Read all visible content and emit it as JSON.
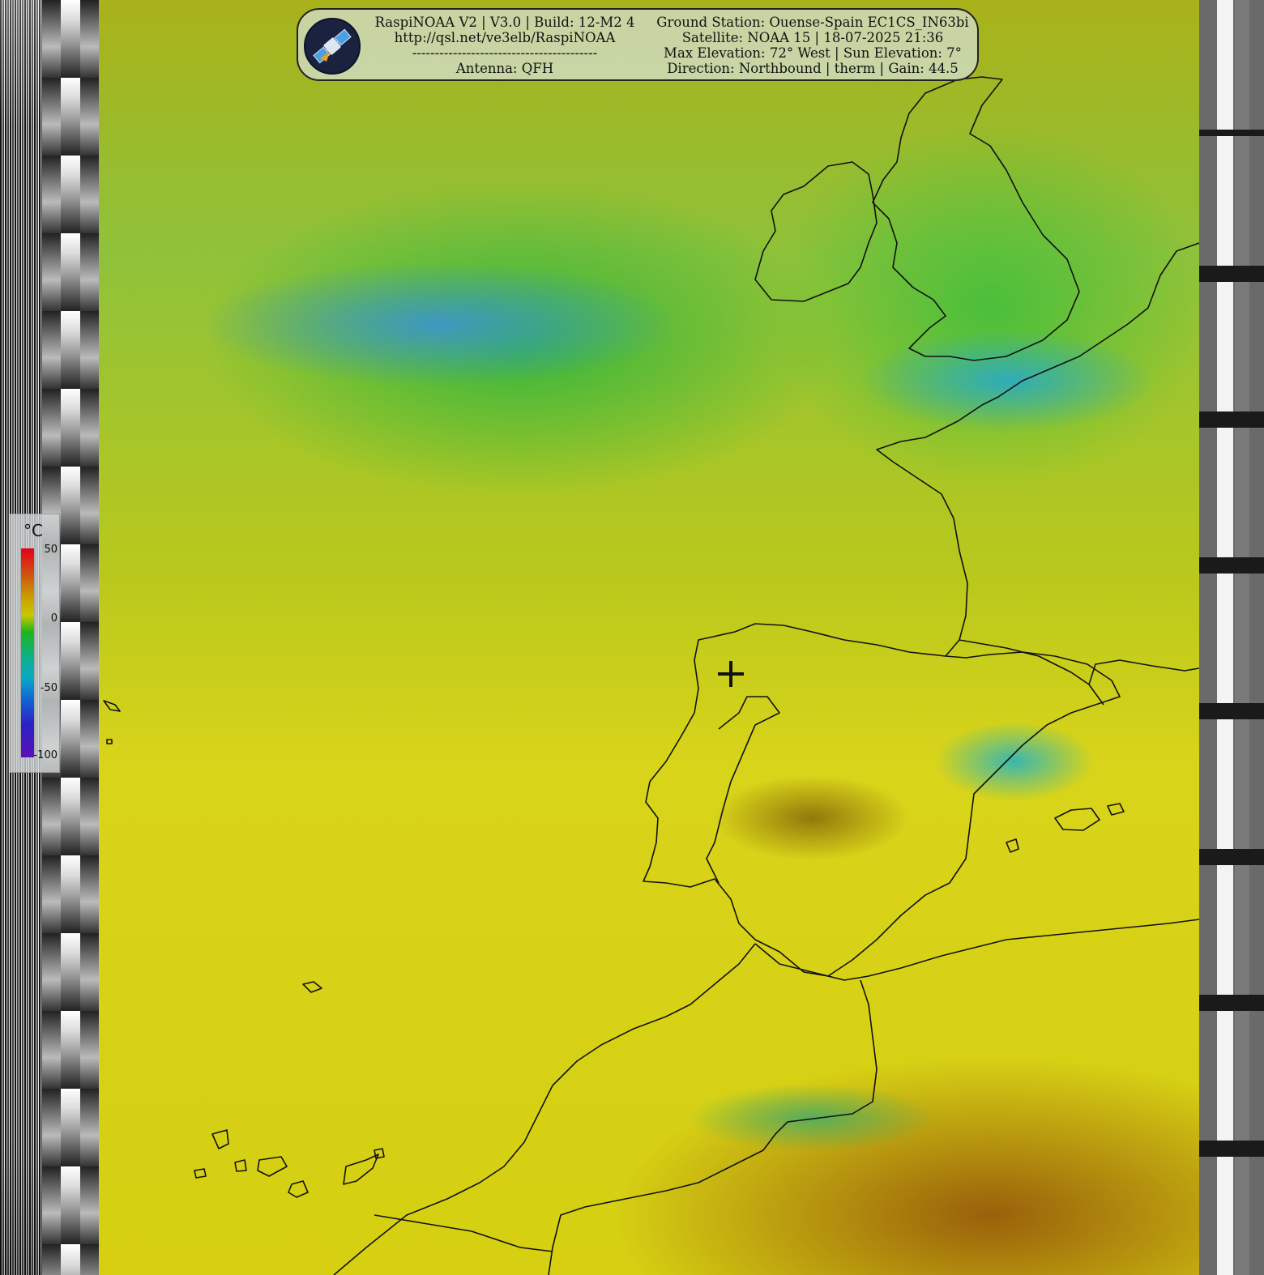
{
  "info_panel": {
    "left_lines": [
      "RaspiNOAA V2 | V3.0 | Build: 12-M2 4",
      "http://qsl.net/ve3elb/RaspiNOAA",
      "-----------------------------------------",
      "Antenna: QFH"
    ],
    "right_lines": [
      "Ground Station: Ouense-Spain EC1CS_IN63bi",
      "Satellite: NOAA 15 | 18-07-2025 21:36",
      "Max Elevation: 72° West | Sun Elevation: 7°",
      "Direction: Northbound | therm | Gain: 44.5"
    ]
  },
  "legend": {
    "unit": "°C",
    "ticks": [
      "50",
      "0",
      "-50",
      "-100"
    ],
    "colors": [
      "#e4001a",
      "#c8c800",
      "#1fb51f",
      "#0aa8c4",
      "#2a22c4",
      "#5a10b8"
    ]
  },
  "icons": {
    "logo": "satellite-icon",
    "marker": "crosshair-icon"
  }
}
